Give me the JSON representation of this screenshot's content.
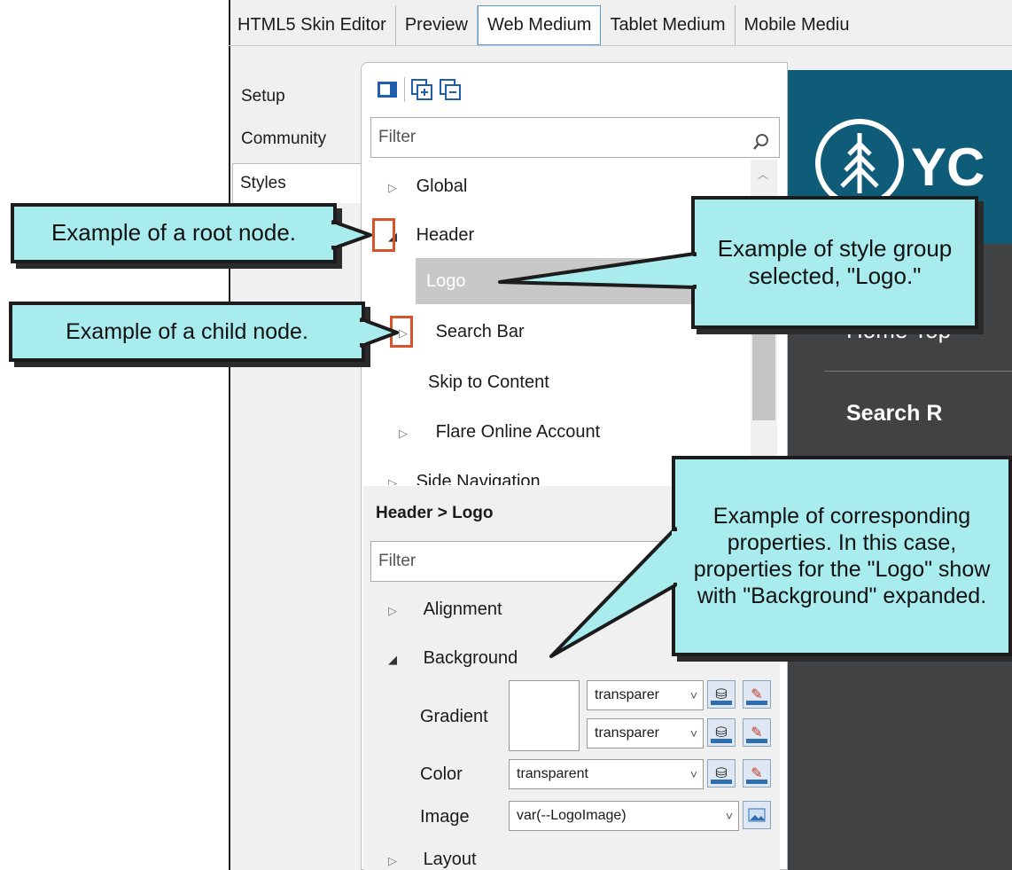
{
  "tabs": [
    "HTML5 Skin Editor",
    "Preview",
    "Web Medium",
    "Tablet Medium",
    "Mobile Mediu"
  ],
  "active_tab_index": 2,
  "sidebar": {
    "items": [
      "Setup",
      "Community",
      "Styles"
    ]
  },
  "filter_placeholder": "Filter",
  "tree": {
    "global": "Global",
    "header": "Header",
    "logo": "Logo",
    "search_bar": "Search Bar",
    "skip_to_content": "Skip to Content",
    "flare_online_account": "Flare Online Account",
    "side_navigation": "Side Navigation"
  },
  "properties": {
    "title": "Header > Logo",
    "filter_placeholder": "Filter",
    "alignment": "Alignment",
    "background": "Background",
    "gradient_label": "Gradient",
    "gradient_value_1": "transparer",
    "gradient_value_2": "transparer",
    "color_label": "Color",
    "color_value": "transparent",
    "image_label": "Image",
    "image_value": "var(--LogoImage)",
    "layout": "Layout"
  },
  "preview": {
    "logo_text": "YC",
    "nav_text": "Home Top",
    "search_text": "Search R"
  },
  "callouts": {
    "root_node": "Example of a root node.",
    "child_node": "Example of a child node.",
    "style_group": "Example of style group selected, \"Logo.\"",
    "properties": "Example of corresponding properties. In this case, properties for the \"Logo\" show with \"Background\" expanded."
  },
  "colors": {
    "callout_fill": "#a8ecee",
    "highlight_border": "#d9532a",
    "preview_header": "#0f5c79",
    "preview_body": "#404244",
    "selected_row": "#c8c8c8"
  }
}
